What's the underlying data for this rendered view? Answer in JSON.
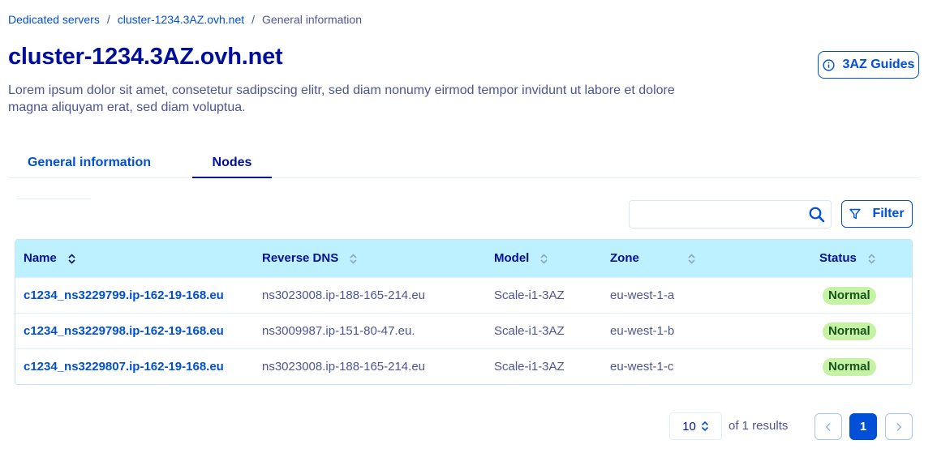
{
  "breadcrumb": {
    "items": [
      "Dedicated servers",
      "cluster-1234.3AZ.ovh.net",
      "General information"
    ],
    "separator": "/"
  },
  "page": {
    "title": "cluster-1234.3AZ.ovh.net",
    "description": "Lorem ipsum dolor sit amet, consetetur sadipscing elitr, sed diam nonumy eirmod tempor invidunt ut labore et dolore magna aliquyam erat, sed diam voluptua.",
    "guides_label": "3AZ Guides",
    "guides_icon": "info-circle-icon"
  },
  "tabs": [
    {
      "label": "General information",
      "active": false
    },
    {
      "label": "Nodes",
      "active": true
    }
  ],
  "toolbar": {
    "search_placeholder": "",
    "search_icon": "magnifier-icon",
    "filter_label": "Filter",
    "filter_icon": "funnel-icon"
  },
  "table": {
    "columns": [
      "Name",
      "Reverse DNS",
      "Model",
      "Zone",
      "Status"
    ],
    "rows": [
      {
        "name": "c1234_ns3229799.ip-162-19-168.eu",
        "dns": "ns3023008.ip-188-165-214.eu",
        "model": "Scale-i1-3AZ",
        "zone": "eu-west-1-a",
        "status": "Normal"
      },
      {
        "name": "c1234_ns3229798.ip-162-19-168.eu",
        "dns": "ns3009987.ip-151-80-47.eu.",
        "model": "Scale-i1-3AZ",
        "zone": "eu-west-1-b",
        "status": "Normal"
      },
      {
        "name": "c1234_ns3229807.ip-162-19-168.eu",
        "dns": "ns3023008.ip-188-165-214.eu",
        "model": "Scale-i1-3AZ",
        "zone": "eu-west-1-c",
        "status": "Normal"
      }
    ]
  },
  "pagination": {
    "page_size": "10",
    "results_text": "of 1 results",
    "current_page": "1"
  },
  "colors": {
    "primary": "#0050d7",
    "heading": "#000e9c",
    "text": "#4d5592",
    "table_header_bg": "#bef1ff",
    "status_badge_bg": "#c5f2a4",
    "status_badge_text": "#17541e"
  }
}
